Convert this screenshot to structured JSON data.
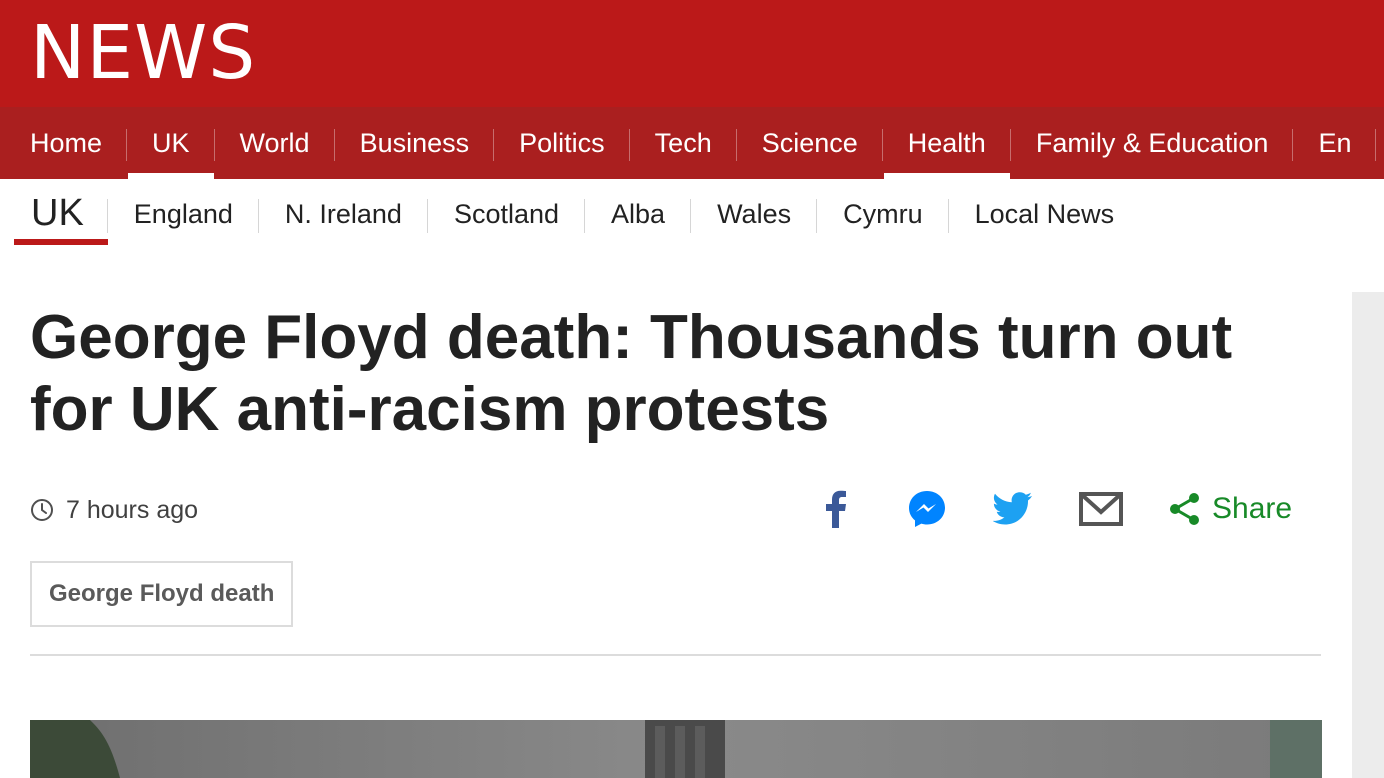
{
  "brand": {
    "logo": "NEWS",
    "accent": "#bb1919",
    "nav_bg": "#aa1f1f"
  },
  "nav": {
    "items": [
      {
        "label": "Home"
      },
      {
        "label": "UK",
        "active": true
      },
      {
        "label": "World"
      },
      {
        "label": "Business"
      },
      {
        "label": "Politics"
      },
      {
        "label": "Tech"
      },
      {
        "label": "Science"
      },
      {
        "label": "Health",
        "active": true
      },
      {
        "label": "Family & Education"
      },
      {
        "label": "En"
      }
    ]
  },
  "subnav": {
    "section": "UK",
    "items": [
      {
        "label": "England"
      },
      {
        "label": "N. Ireland"
      },
      {
        "label": "Scotland"
      },
      {
        "label": "Alba"
      },
      {
        "label": "Wales"
      },
      {
        "label": "Cymru"
      },
      {
        "label": "Local News"
      }
    ]
  },
  "article": {
    "headline_line1": "George Floyd death: Thousands turn out",
    "headline_line2": "for UK anti-racism protests",
    "timestamp": "7 hours ago",
    "topic_tag": "George Floyd death"
  },
  "share": {
    "label": "Share",
    "icons": [
      "facebook-icon",
      "messenger-icon",
      "twitter-icon",
      "email-icon",
      "share-icon"
    ],
    "colors": {
      "facebook": "#3b5998",
      "messenger": "#0084ff",
      "twitter": "#1da1f2",
      "email": "#555555",
      "share": "#188a28"
    }
  }
}
